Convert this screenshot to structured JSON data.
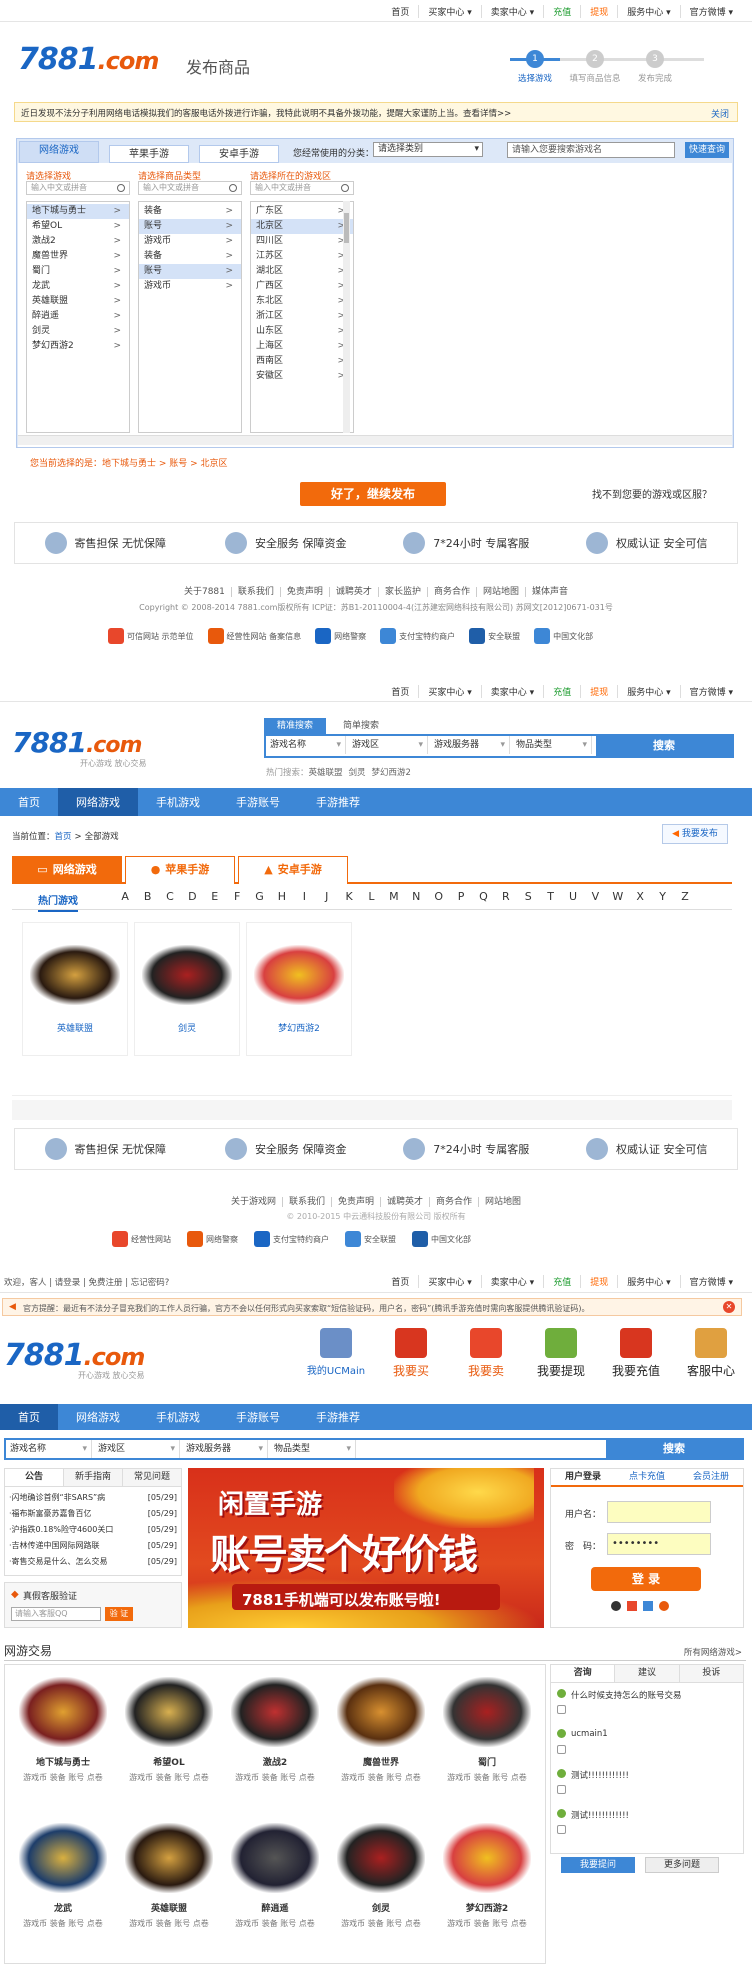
{
  "panel1": {
    "topbar": [
      "首页",
      "买家中心 ▾",
      "卖家中心 ▾",
      "充值",
      "提现",
      "服务中心 ▾",
      "官方微博 ▾"
    ],
    "logo_main": "7881",
    "logo_suffix": ".com",
    "page_title": "发布商品",
    "steps": [
      {
        "num": "1",
        "label": "选择游戏"
      },
      {
        "num": "2",
        "label": "填写商品信息"
      },
      {
        "num": "3",
        "label": "发布完成"
      }
    ],
    "notice": "近日发现不法分子利用网络电话模拟我们的客服电话外拨进行诈骗，我特此说明不具备外拨功能，提醒大家谨防上当。查看详情>>",
    "notice_close": "关闭",
    "tabs": [
      "网络游戏",
      "苹果手游",
      "安卓手游"
    ],
    "category_label": "您经常使用的分类：",
    "category_select": "请选择类别",
    "search_placeholder": "请输入您要搜索游戏名",
    "search_btn": "快速查询",
    "col_titles": [
      "请选择游戏",
      "请选择商品类型",
      "请选择所在的游戏区"
    ],
    "col_placeholder": "输入中文或拼音",
    "games": [
      "地下城与勇士",
      "希望OL",
      "激战2",
      "魔兽世界",
      "蜀门",
      "龙武",
      "英雄联盟",
      "醉逍遥",
      "剑灵",
      "梦幻西游2"
    ],
    "types": [
      "装备",
      "账号",
      "游戏币",
      "装备",
      "账号",
      "游戏币"
    ],
    "regions": [
      "广东区",
      "北京区",
      "四川区",
      "江苏区",
      "湖北区",
      "广西区",
      "东北区",
      "浙江区",
      "山东区",
      "上海区",
      "西南区",
      "安徽区"
    ],
    "current_label": "您当前选择的是：",
    "current_value": "地下城与勇士 > 账号 > 北京区",
    "continue_btn": "好了，继续发布",
    "not_found": "找不到您要的游戏或区服？",
    "guarantees": [
      "寄售担保  无忧保障",
      "安全服务  保障资金",
      "7*24小时  专属客服",
      "权威认证  安全可信"
    ],
    "footer_links": [
      "关于7881",
      "联系我们",
      "免责声明",
      "诚聘英才",
      "家长监护",
      "商务合作",
      "网站地图",
      "媒体声音"
    ],
    "copyright": "Copyright © 2008-2014 7881.com版权所有  ICP证：苏B1-20110004-4(江苏建宏网络科技有限公司)  苏网文[2012]0671-031号",
    "badges": [
      "可信网站 示范单位",
      "经营性网站 备案信息",
      "网络警察",
      "支付宝特约商户",
      "安全联盟",
      "中国文化部"
    ]
  },
  "panel2": {
    "topbar": [
      "首页",
      "买家中心 ▾",
      "卖家中心 ▾",
      "充值",
      "提现",
      "服务中心 ▾",
      "官方微博 ▾"
    ],
    "slogan": "开心游戏 放心交易",
    "search_tabs": [
      "精准搜索",
      "简单搜索"
    ],
    "search_fields": [
      "游戏名称",
      "游戏区",
      "游戏服务器",
      "物品类型"
    ],
    "search_btn": "搜索",
    "hot_label": "热门搜索：",
    "hot_items": [
      "英雄联盟",
      "剑灵",
      "梦幻西游2"
    ],
    "nav": [
      "首页",
      "网络游戏",
      "手机游戏",
      "手游账号",
      "手游推荐"
    ],
    "breadcrumb_label": "当前位置：",
    "breadcrumb": [
      "首页",
      ">",
      "全部游戏"
    ],
    "publish_btn": "我要发布",
    "cat_tabs": [
      "网络游戏",
      "苹果手游",
      "安卓手游"
    ],
    "letters_hot": "热门游戏",
    "letters": [
      "A",
      "B",
      "C",
      "D",
      "E",
      "F",
      "G",
      "H",
      "I",
      "J",
      "K",
      "L",
      "M",
      "N",
      "O",
      "P",
      "Q",
      "R",
      "S",
      "T",
      "U",
      "V",
      "W",
      "X",
      "Y",
      "Z"
    ],
    "games": [
      "英雄联盟",
      "剑灵",
      "梦幻西游2"
    ],
    "guarantees": [
      "寄售担保  无忧保障",
      "安全服务  保障资金",
      "7*24小时  专属客服",
      "权威认证  安全可信"
    ],
    "footer_links": [
      "关于游戏网",
      "联系我们",
      "免责声明",
      "诚聘英才",
      "商务合作",
      "网站地图"
    ],
    "copyright": "© 2010-2015 中云通科技股份有限公司 版权所有",
    "badges": [
      "经营性网站",
      "网络警察",
      "支付宝特约商户",
      "安全联盟",
      "中国文化部"
    ]
  },
  "panel3": {
    "welcome": "欢迎，客人 | 请登录 | 免费注册 | 忘记密码?",
    "topbar": [
      "首页",
      "买家中心 ▾",
      "卖家中心 ▾",
      "充值",
      "提现",
      "服务中心 ▾",
      "官方微博 ▾"
    ],
    "warning": "官方提醒：最近有不法分子冒充我们的工作人员行骗，官方不会以任何形式向买家索取“短信验证码，用户名，密码”(腾讯手游充值时需向客服提供腾讯验证码)。",
    "slogan": "开心游戏 放心交易",
    "quick": [
      {
        "label": "我的UCMain",
        "color": "#1a66c4"
      },
      {
        "label": "我要买",
        "color": "#e8590c"
      },
      {
        "label": "我要卖",
        "color": "#e8590c"
      },
      {
        "label": "我要提现",
        "color": "#222"
      },
      {
        "label": "我要充值",
        "color": "#222"
      },
      {
        "label": "客服中心",
        "color": "#222"
      }
    ],
    "nav": [
      "首页",
      "网络游戏",
      "手机游戏",
      "手游账号",
      "手游推荐"
    ],
    "search_fields": [
      "游戏名称",
      "游戏区",
      "游戏服务器",
      "物品类型"
    ],
    "search_btn": "搜索",
    "news_tabs": [
      "公告",
      "新手指南",
      "常见问题"
    ],
    "news": [
      {
        "t": "·闪地确诊首例“非SARS”病",
        "d": "[05/29]"
      },
      {
        "t": "·福布斯富豪苏嘉鲁百亿",
        "d": "[05/29]"
      },
      {
        "t": "·沪指跌0.18%险守4600关口",
        "d": "[05/29]"
      },
      {
        "t": "·吉林传递中国网际网路联",
        "d": "[05/29]"
      },
      {
        "t": "·寄售交易是什么、怎么交易",
        "d": "[05/29]"
      }
    ],
    "verify_title": "真假客服验证",
    "verify_placeholder": "请输入客服QQ",
    "verify_btn": "验 证",
    "banner_line1": "闲置手游",
    "banner_line2": "账号卖个好价钱",
    "banner_line3": "7881手机端可以发布账号啦!",
    "login_tabs": [
      "用户登录",
      "点卡充值",
      "会员注册"
    ],
    "username_label": "用户名：",
    "password_label": "密　码：",
    "password_value": "••••••••",
    "login_btn": "登 录",
    "section_title": "网游交易",
    "section_more": "所有网络游戏>",
    "games": [
      "地下城与勇士",
      "希望OL",
      "激战2",
      "魔兽世界",
      "蜀门",
      "龙武",
      "英雄联盟",
      "醉逍遥",
      "剑灵",
      "梦幻西游2"
    ],
    "game_links": "游戏币 装备 账号 点卷",
    "qa_tabs": [
      "咨询",
      "建议",
      "投诉"
    ],
    "qa": [
      "什么时候支持怎么的账号交易",
      "ucmain1",
      "测试!!!!!!!!!!!!",
      "测试!!!!!!!!!!!!"
    ],
    "ask_btn": "我要提问",
    "more_btn": "更多问题"
  },
  "colors": {
    "blue": "#3d87d6",
    "navy": "#1f5ea8",
    "orange": "#f26a0c",
    "logo_blue": "#1a66c4"
  }
}
